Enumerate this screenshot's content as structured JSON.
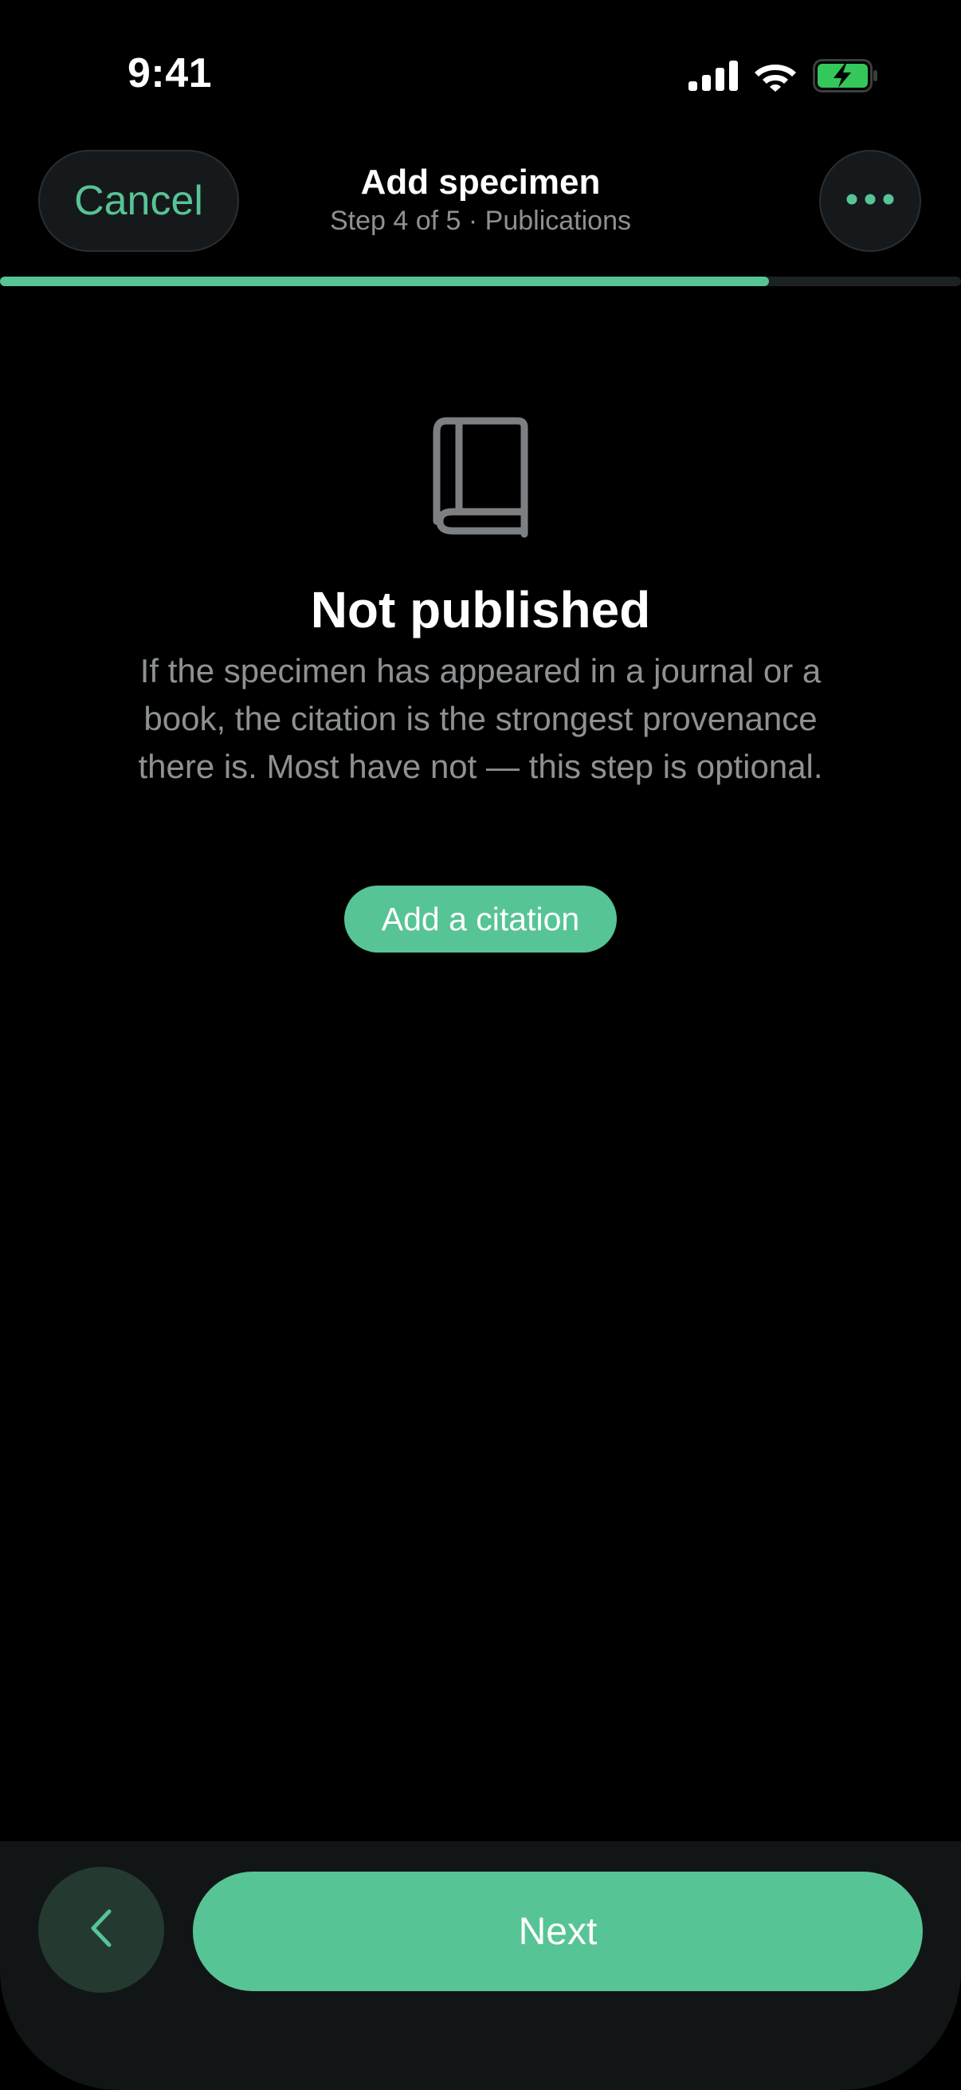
{
  "status_bar": {
    "time": "9:41",
    "icons": [
      "cellular-signal-icon",
      "wifi-icon",
      "battery-charging-icon"
    ],
    "battery_color": "#34c759"
  },
  "header": {
    "cancel_label": "Cancel",
    "title": "Add specimen",
    "subtitle": "Step 4 of 5 · Publications",
    "more_icon": "more-dots-icon"
  },
  "progress": {
    "current_step": 4,
    "total_steps": 5,
    "fraction": 0.8
  },
  "empty_state": {
    "icon": "book-icon",
    "title": "Not published",
    "body": "If the specimen has appeared in a journal or a book, the citation is the strongest provenance there is. Most have not — this step is optional.",
    "action_label": "Add a citation"
  },
  "footer": {
    "back_icon": "chevron-left-icon",
    "next_label": "Next"
  },
  "colors": {
    "accent": "#57c495",
    "background": "#000000",
    "muted_text": "#8e9193"
  }
}
